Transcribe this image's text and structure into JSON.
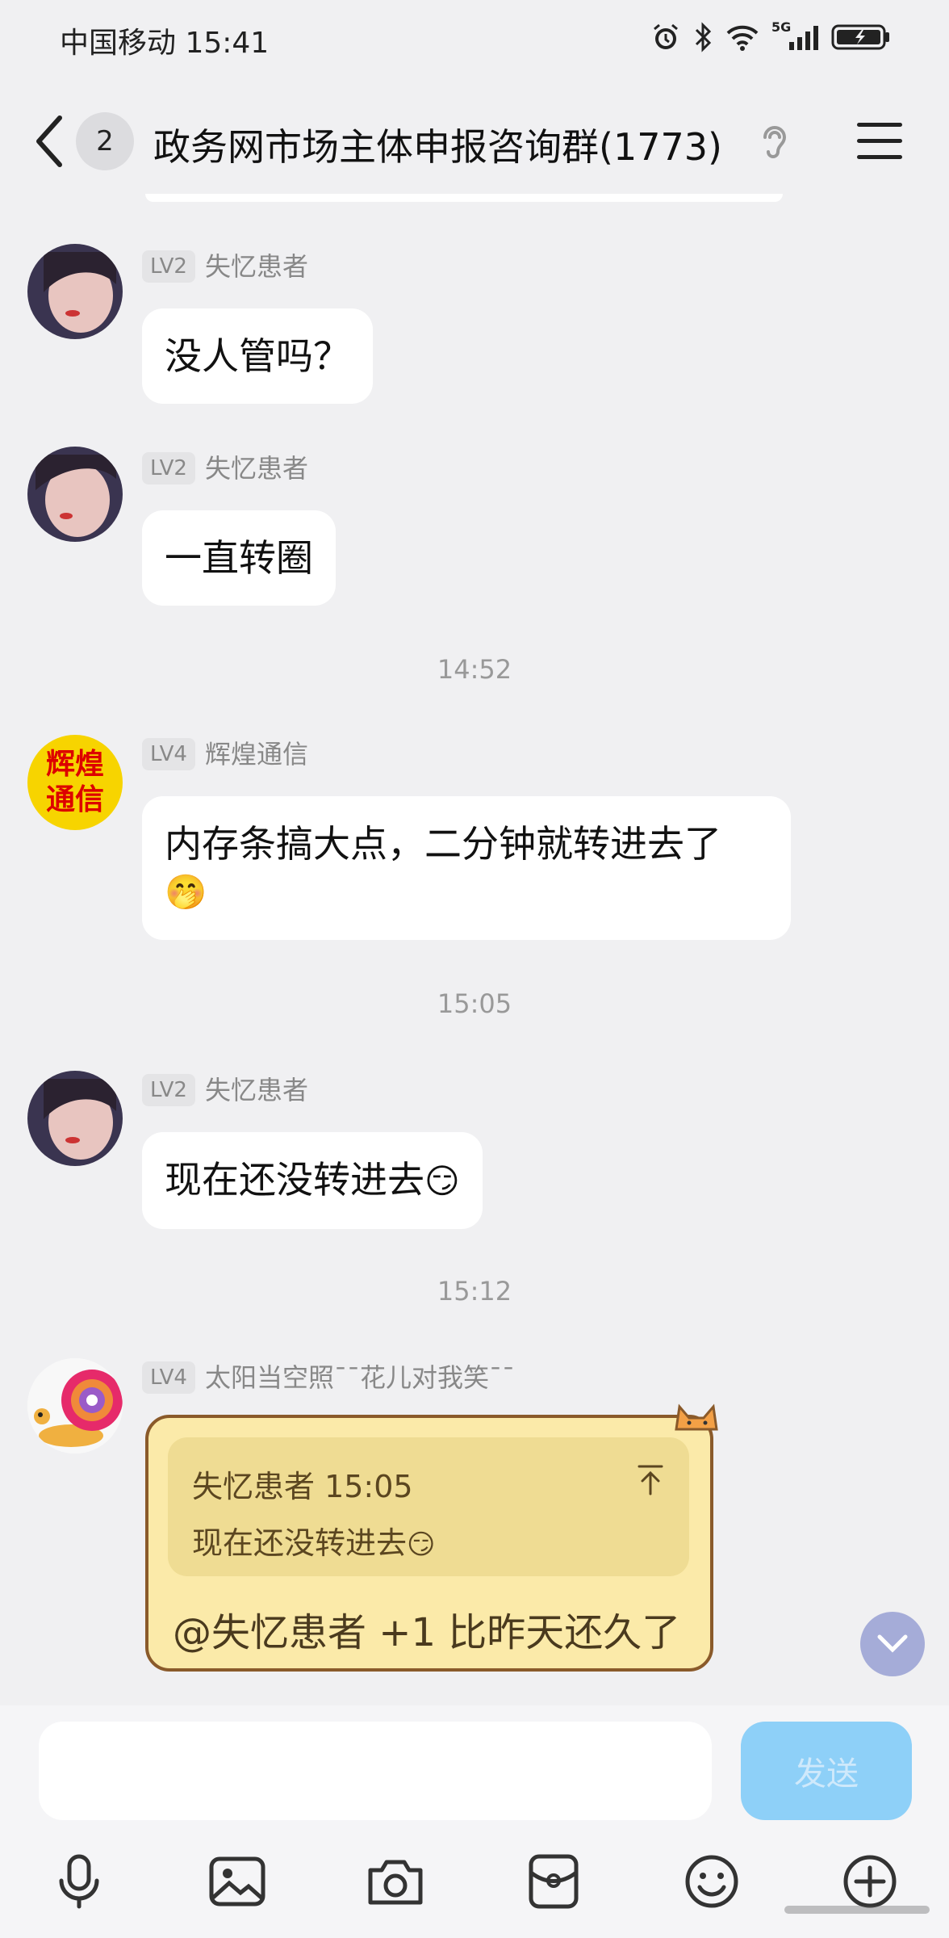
{
  "status_bar": {
    "carrier": "中国移动 15:41",
    "network": "5G"
  },
  "header": {
    "unread_count": "2",
    "title": "政务网市场主体申报咨询群(1773)"
  },
  "messages": [
    {
      "level": "LV2",
      "sender": "失忆患者",
      "text": "没人管吗？"
    },
    {
      "level": "LV2",
      "sender": "失忆患者",
      "text": "一直转圈"
    },
    {
      "timestamp": "14:52"
    },
    {
      "level": "LV4",
      "sender": "辉煌通信",
      "avatar_text": [
        "辉煌",
        "通信"
      ],
      "text": "内存条搞大点，二分钟就转进去了",
      "emoji": "🤭"
    },
    {
      "timestamp": "15:05"
    },
    {
      "level": "LV2",
      "sender": "失忆患者",
      "text": "现在还没转进去",
      "emoji": "😏"
    },
    {
      "timestamp": "15:12"
    },
    {
      "level": "LV4",
      "sender": "太阳当空照ˉˉ花儿对我笑ˉˉ",
      "quote_sender_time": "失忆患者 15:05",
      "quote_text": "现在还没转进去",
      "quote_emoji": "😏",
      "text": "@失忆患者 +1  比昨天还久了"
    }
  ],
  "input": {
    "placeholder": "",
    "send_label": "发送"
  },
  "colors": {
    "background": "#f0f0f2",
    "bubble": "#ffffff",
    "send_button": "#8ed0f8",
    "cute_bubble": "#fbeaa9"
  },
  "toolbar_icons": [
    "microphone-icon",
    "image-icon",
    "camera-icon",
    "red-packet-icon",
    "emoji-icon",
    "plus-icon"
  ]
}
